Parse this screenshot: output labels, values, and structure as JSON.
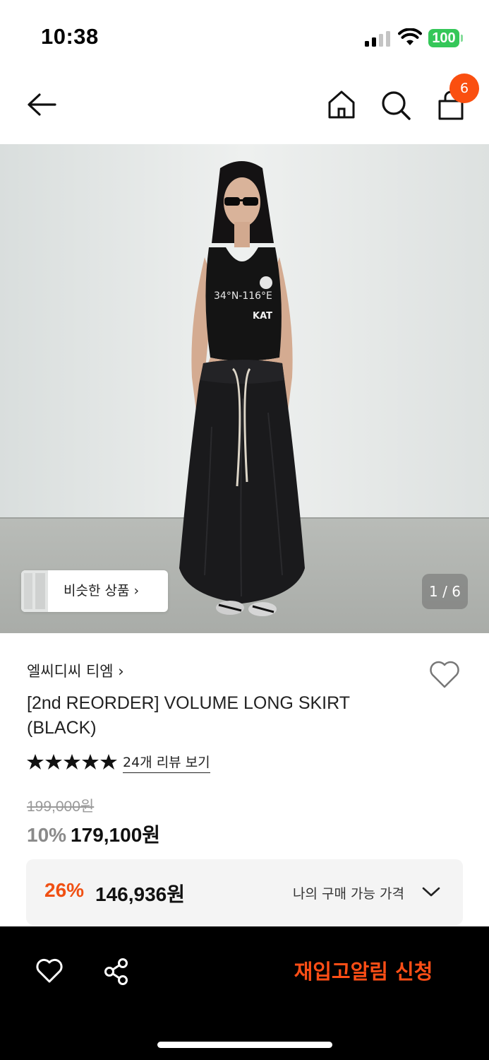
{
  "status_bar": {
    "time": "10:38",
    "battery": "100",
    "icons": [
      "cellular-signal-icon",
      "wifi-icon",
      "battery-icon"
    ],
    "battery_color": "#35c759"
  },
  "nav": {
    "icons": [
      "arrow-left-icon",
      "home-icon",
      "search-icon",
      "shopping-bag-icon"
    ],
    "cart_count": "6",
    "badge_color": "#fa4f10"
  },
  "product_image": {
    "print_line1": "34°N-116°E",
    "print_line2": "KAT"
  },
  "gallery": {
    "similar_label": "비슷한 상품 ›",
    "counter": "1 / 6"
  },
  "product": {
    "brand": "엘씨디씨 티엠 ›",
    "title": "[2nd REORDER] VOLUME LONG SKIRT (BLACK)",
    "rating_stars": 5,
    "review_link": "24개 리뷰 보기",
    "original_price": "199,000원",
    "discount_rate": "10%",
    "sale_price": "179,100원"
  },
  "my_price": {
    "rate": "26%",
    "price": "146,936원",
    "label": "나의 구매 가능 가격",
    "accent_color": "#f05013"
  },
  "bottom_bar": {
    "restock_button": "재입고알림 신청",
    "icons": [
      "heart-icon",
      "share-icon"
    ],
    "accent_color": "#ff4e16"
  }
}
